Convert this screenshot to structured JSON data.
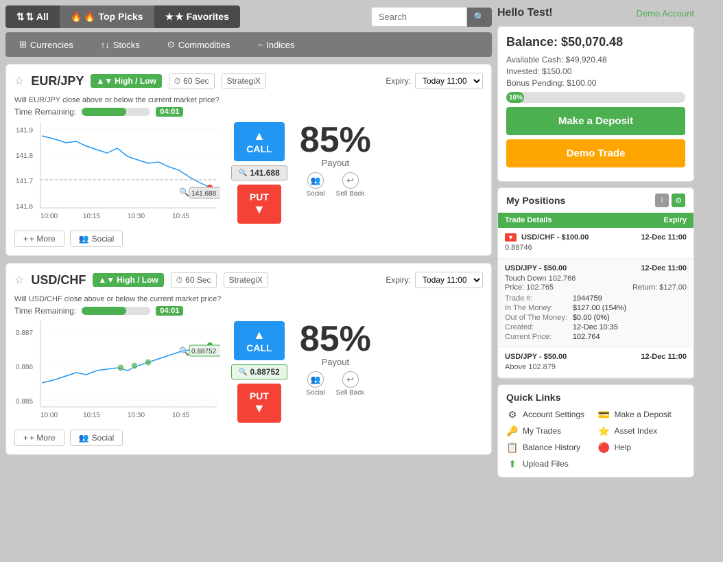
{
  "header": {
    "nav_all": "⇅ All",
    "nav_top_picks": "🔥 Top Picks",
    "nav_favorites": "★ Favorites",
    "search_placeholder": "Search",
    "search_btn": "🔍"
  },
  "subnav": {
    "items": [
      {
        "label": "Currencies",
        "icon": "⊞"
      },
      {
        "label": "Stocks",
        "icon": "↑↓"
      },
      {
        "label": "Commodities",
        "icon": "⊙"
      },
      {
        "label": "Indices",
        "icon": "~"
      }
    ]
  },
  "cards": [
    {
      "asset": "EUR/JPY",
      "badge": "High / Low",
      "timer": "60 Sec",
      "strategix": "StrategiX",
      "expiry_label": "Expiry:",
      "expiry_value": "Today 11:00",
      "question": "Will EUR/JPY close above or below the current market price?",
      "time_remaining_label": "Time Remaining:",
      "time_value": "04:01",
      "price": "141.688",
      "payout": "85%",
      "payout_label": "Payout",
      "call_label": "CALL",
      "put_label": "PUT",
      "social_label": "Social",
      "sell_back_label": "Sell Back",
      "more_label": "+ More",
      "chart_y": [
        "141.9",
        "141.8",
        "141.7",
        "141.6"
      ],
      "chart_x": [
        "10:00",
        "10:15",
        "10:30",
        "10:45"
      ]
    },
    {
      "asset": "USD/CHF",
      "badge": "High / Low",
      "timer": "60 Sec",
      "strategix": "StrategiX",
      "expiry_label": "Expiry:",
      "expiry_value": "Today 11:00",
      "question": "Will USD/CHF close above or below the current market price?",
      "time_remaining_label": "Time Remaining:",
      "time_value": "04:01",
      "price": "0.88752",
      "payout": "85%",
      "payout_label": "Payout",
      "call_label": "CALL",
      "put_label": "PUT",
      "social_label": "Social",
      "sell_back_label": "Sell Back",
      "more_label": "+ More",
      "chart_y": [
        "0.887",
        "0.886",
        "0.885"
      ],
      "chart_x": [
        "10:00",
        "10:15",
        "10:30",
        "10:45"
      ]
    }
  ],
  "right": {
    "greeting": "Hello Test!",
    "demo_account": "Demo Account",
    "balance_title": "Balance: $50,070.48",
    "available_cash": "Available Cash: $49,920.48",
    "invested": "Invested: $150.00",
    "bonus_pending": "Bonus Pending: $100.00",
    "progress_text": "10%",
    "deposit_btn": "Make a Deposit",
    "demo_trade_btn": "Demo Trade",
    "positions_title": "My Positions",
    "positions_col_trade": "Trade Details",
    "positions_col_expiry": "Expiry",
    "positions": [
      {
        "trade": "USD/CHF - $100.00",
        "expiry": "12-Dec 11:00",
        "sub": "0.88746",
        "badge": "▼",
        "detail": null
      },
      {
        "trade": "USD/JPY - $50.00",
        "expiry": "12-Dec 11:00",
        "sub": null,
        "badge": null,
        "touch_down": "Touch Down 102.766",
        "price": "Price: 102.765",
        "return": "Return: $127.00",
        "trade_num_label": "Trade #:",
        "trade_num_val": "1944759",
        "in_money_label": "In The Money:",
        "in_money_val": "$127.00 (154%)",
        "out_money_label": "Out of The Money:",
        "out_money_val": "$0.00 (0%)",
        "created_label": "Created:",
        "created_val": "12-Dec 10:35",
        "current_price_label": "Current Price:",
        "current_price_val": "102.764"
      },
      {
        "trade": "USD/JPY - $50.00",
        "expiry": "12-Dec 11:00",
        "sub": "Above 102.879",
        "badge": null,
        "detail": null
      }
    ],
    "quick_links_title": "Quick Links",
    "quick_links": [
      {
        "label": "Account Settings",
        "icon": "⚙",
        "color": "#666"
      },
      {
        "label": "Make a Deposit",
        "icon": "💳",
        "color": "#2196F3"
      },
      {
        "label": "My Trades",
        "icon": "🔑",
        "color": "#FFA500"
      },
      {
        "label": "Asset Index",
        "icon": "⭐",
        "color": "#FFA500"
      },
      {
        "label": "Balance History",
        "icon": "📋",
        "color": "#666"
      },
      {
        "label": "Help",
        "icon": "🔴",
        "color": "#F44336"
      },
      {
        "label": "Upload Files",
        "icon": "⬆",
        "color": "#4caf50"
      }
    ]
  }
}
